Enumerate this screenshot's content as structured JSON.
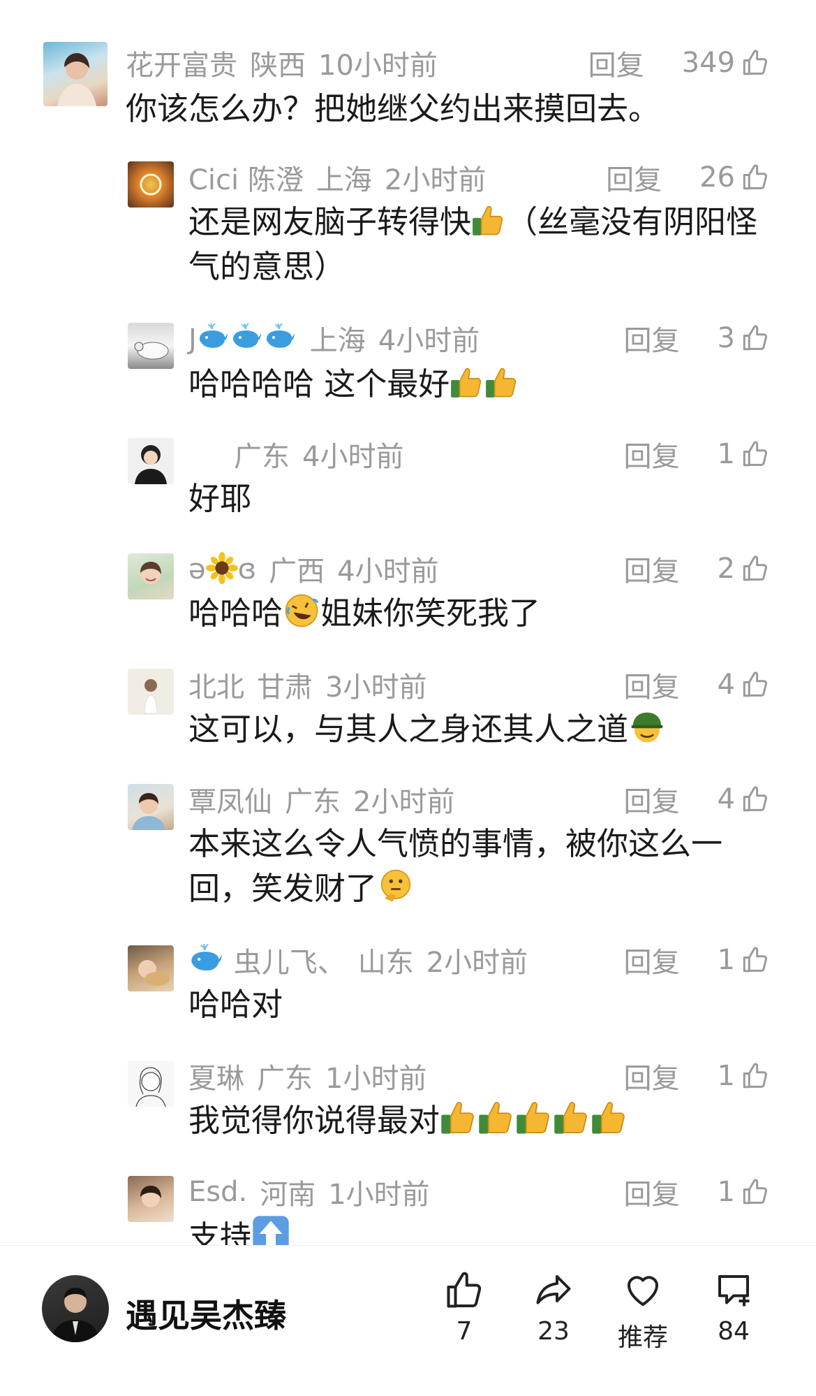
{
  "main_comment": {
    "username": "花开富贵",
    "location": "陕西",
    "time": "10小时前",
    "reply_label": "回复",
    "likes": "349",
    "content": "你该怎么办？把她继父约出来摸回去。"
  },
  "replies": [
    {
      "username": "Cici 陈澄",
      "location": "上海",
      "time": "2小时前",
      "reply_label": "回复",
      "likes": "26",
      "content_a": "还是网友脑子转得快",
      "content_b": "（丝毫没有阴阳怪",
      "content_line2": "气的意思）"
    },
    {
      "username": "J",
      "location": "上海",
      "time": "4小时前",
      "reply_label": "回复",
      "likes": "3",
      "content": "哈哈哈哈 这个最好"
    },
    {
      "username": "",
      "location": "广东",
      "time": "4小时前",
      "reply_label": "回复",
      "likes": "1",
      "content": "好耶"
    },
    {
      "username_a": "ə",
      "username_b": "ɞ",
      "location": "广西",
      "time": "4小时前",
      "reply_label": "回复",
      "likes": "2",
      "content_a": "哈哈哈",
      "content_b": "姐妹你笑死我了"
    },
    {
      "username": "北北",
      "location": "甘肃",
      "time": "3小时前",
      "reply_label": "回复",
      "likes": "4",
      "content": "这可以，与其人之身还其人之道"
    },
    {
      "username": "覃凤仙",
      "location": "广东",
      "time": "2小时前",
      "reply_label": "回复",
      "likes": "4",
      "content_line1": "本来这么令人气愤的事情，被你这么一",
      "content_line2": "回，笑发财了"
    },
    {
      "username": "虫儿飞、",
      "location": "山东",
      "time": "2小时前",
      "reply_label": "回复",
      "likes": "1",
      "content": "哈哈对"
    },
    {
      "username": "夏琳",
      "location": "广东",
      "time": "1小时前",
      "reply_label": "回复",
      "likes": "1",
      "content": "我觉得你说得最对"
    },
    {
      "username": "Esd.",
      "location": "河南",
      "time": "1小时前",
      "reply_label": "回复",
      "likes": "1",
      "content": "支持"
    }
  ],
  "bottom_bar": {
    "author_name": "遇见吴杰臻",
    "like_count": "7",
    "share_count": "23",
    "recommend_label": "推荐",
    "comment_count": "84"
  },
  "icons": {
    "like": "thumbs-up-outline-icon",
    "share": "share-arrow-icon",
    "recommend": "heart-outline-icon",
    "comment": "comment-plus-icon"
  },
  "colors": {
    "meta_text": "#9a9a9a",
    "content_text": "#1a1a1a",
    "thumbs_emoji": "#f5b731"
  }
}
